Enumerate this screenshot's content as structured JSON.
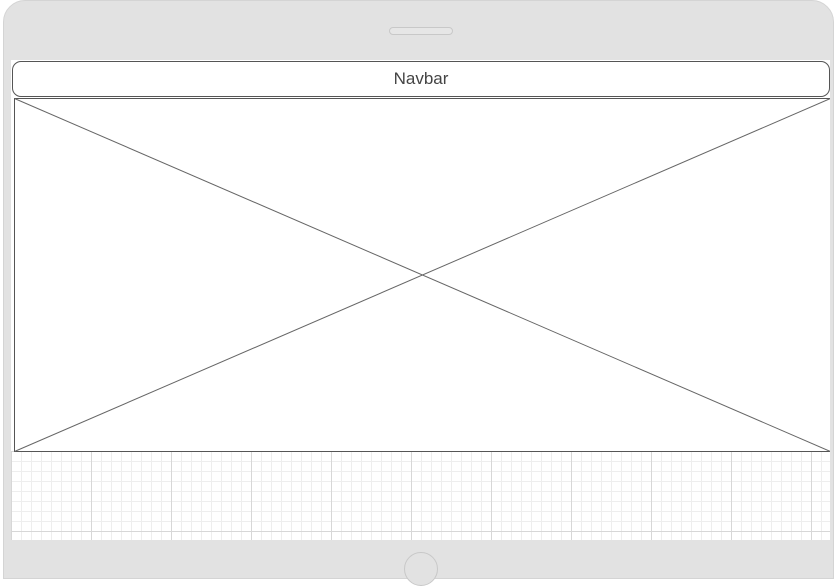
{
  "navbar": {
    "label": "Navbar"
  },
  "colors": {
    "device_frame": "#e2e2e2",
    "screen_background": "#ffffff",
    "outline": "#555555",
    "placeholder_stroke": "#666666",
    "grid_major": "#d7d7d7",
    "grid_minor": "#eeeeee"
  },
  "icons": {
    "speaker": "speaker-slot-icon",
    "home": "home-button-icon",
    "image": "image-placeholder-icon"
  }
}
